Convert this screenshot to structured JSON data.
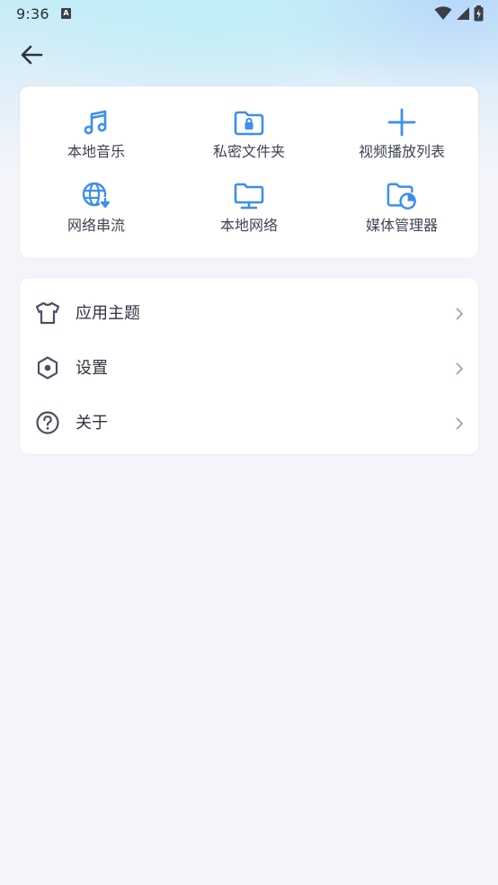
{
  "status_bar": {
    "time": "9:36",
    "input_badge": "A"
  },
  "colors": {
    "accent": "#3d8ef0",
    "text_primary": "#2f3340",
    "text_secondary": "#3f4452",
    "chevron": "#9aa3b2"
  },
  "quick_actions": [
    {
      "label": "本地音乐",
      "icon": "music-note-icon"
    },
    {
      "label": "私密文件夹",
      "icon": "lock-folder-icon"
    },
    {
      "label": "视频播放列表",
      "icon": "plus-icon"
    },
    {
      "label": "网络串流",
      "icon": "globe-download-icon"
    },
    {
      "label": "本地网络",
      "icon": "monitor-folder-icon"
    },
    {
      "label": "媒体管理器",
      "icon": "pie-folder-icon"
    }
  ],
  "menu": [
    {
      "label": "应用主题",
      "icon": "tshirt-icon"
    },
    {
      "label": "设置",
      "icon": "hexagon-settings-icon"
    },
    {
      "label": "关于",
      "icon": "question-circle-icon"
    }
  ]
}
